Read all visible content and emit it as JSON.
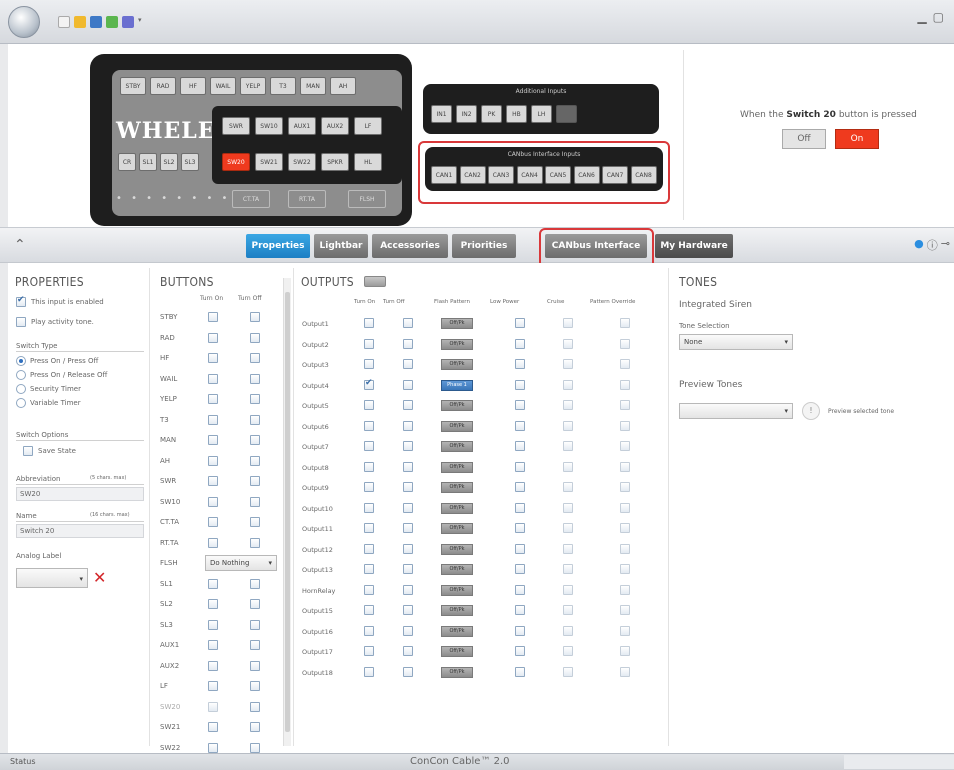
{
  "window": {
    "title": "",
    "status_left": "Status",
    "status_center": "ConCon Cable™ 2.0"
  },
  "console": {
    "brand": "WHELEN",
    "buttons_row1": [
      "STBY",
      "RAD",
      "HF",
      "WAIL",
      "YELP",
      "T3",
      "MAN",
      "AH"
    ],
    "left_row3": [
      "CR",
      "SL1",
      "SL2",
      "SL3"
    ],
    "block_row1": [
      "SWR",
      "SW10",
      "AUX1",
      "AUX2",
      "LF"
    ],
    "block_row2": [
      "SW20",
      "SW21",
      "SW22",
      "SPKR",
      "HL"
    ],
    "bottom_row": [
      "CT.TA",
      "RT.TA",
      "FLSH"
    ],
    "dots": "• • • • • • • •"
  },
  "additional_inputs": {
    "title": "Additional Inputs",
    "buttons": [
      "IN1",
      "IN2",
      "PK",
      "HB",
      "LH",
      ""
    ]
  },
  "canbus_inputs": {
    "title": "CANbus Interface Inputs",
    "buttons": [
      "CAN1",
      "CAN2",
      "CAN3",
      "CAN4",
      "CAN5",
      "CAN6",
      "CAN7",
      "CAN8"
    ]
  },
  "switch_info": {
    "prefix": "When the",
    "switch": "Switch 20",
    "suffix": "button is pressed",
    "off": "Off",
    "on": "On"
  },
  "tabs": [
    "Properties",
    "Lightbar",
    "Accessories",
    "Priorities",
    "CANbus Interface",
    "My Hardware"
  ],
  "properties": {
    "heading": "PROPERTIES",
    "enabled": "This input is enabled",
    "tone": "Play activity tone.",
    "switch_type": "Switch Type",
    "radios": [
      "Press On / Press Off",
      "Press On / Release Off",
      "Security Timer",
      "Variable Timer"
    ],
    "switch_options": "Switch Options",
    "save_state": "Save State",
    "abbreviation_label": "Abbreviation",
    "abbreviation_hint": "(5 chars. max)",
    "abbreviation_value": "SW20",
    "name_label": "Name",
    "name_hint": "(16 chars. max)",
    "name_value": "Switch 20",
    "analog_label": "Analog Label"
  },
  "buttons_panel": {
    "heading": "BUTTONS",
    "col_on": "Turn On",
    "col_off": "Turn Off",
    "rows": [
      "STBY",
      "RAD",
      "HF",
      "WAIL",
      "YELP",
      "T3",
      "MAN",
      "AH",
      "SWR",
      "SW10",
      "CT.TA",
      "RT.TA",
      "FLSH",
      "SL1",
      "SL2",
      "SL3",
      "AUX1",
      "AUX2",
      "LF",
      "SW20",
      "SW21",
      "SW22"
    ],
    "flsh_dropdown": "Do Nothing"
  },
  "outputs_panel": {
    "heading": "OUTPUTS",
    "cols": [
      "Turn On",
      "Turn Off",
      "Flash Pattern",
      "Low Power",
      "Cruise",
      "Pattern Override"
    ],
    "rows": [
      "Output1",
      "Output2",
      "Output3",
      "Output4",
      "Output5",
      "Output6",
      "Output7",
      "Output8",
      "Output9",
      "Output10",
      "Output11",
      "Output12",
      "Output13",
      "HornRelay",
      "Output15",
      "Output16",
      "Output17",
      "Output18"
    ],
    "flash_label": "Off/Pk",
    "flash_active": "Phase 1"
  },
  "tones": {
    "heading": "TONES",
    "integrated": "Integrated Siren",
    "tone_selection": "Tone Selection",
    "tone_value": "None",
    "preview": "Preview Tones",
    "preview_action": "Preview selected tone"
  },
  "colors": {
    "accent": "#1d7fc4",
    "active_red": "#ef3a1e",
    "highlight_box": "#d9383a"
  }
}
